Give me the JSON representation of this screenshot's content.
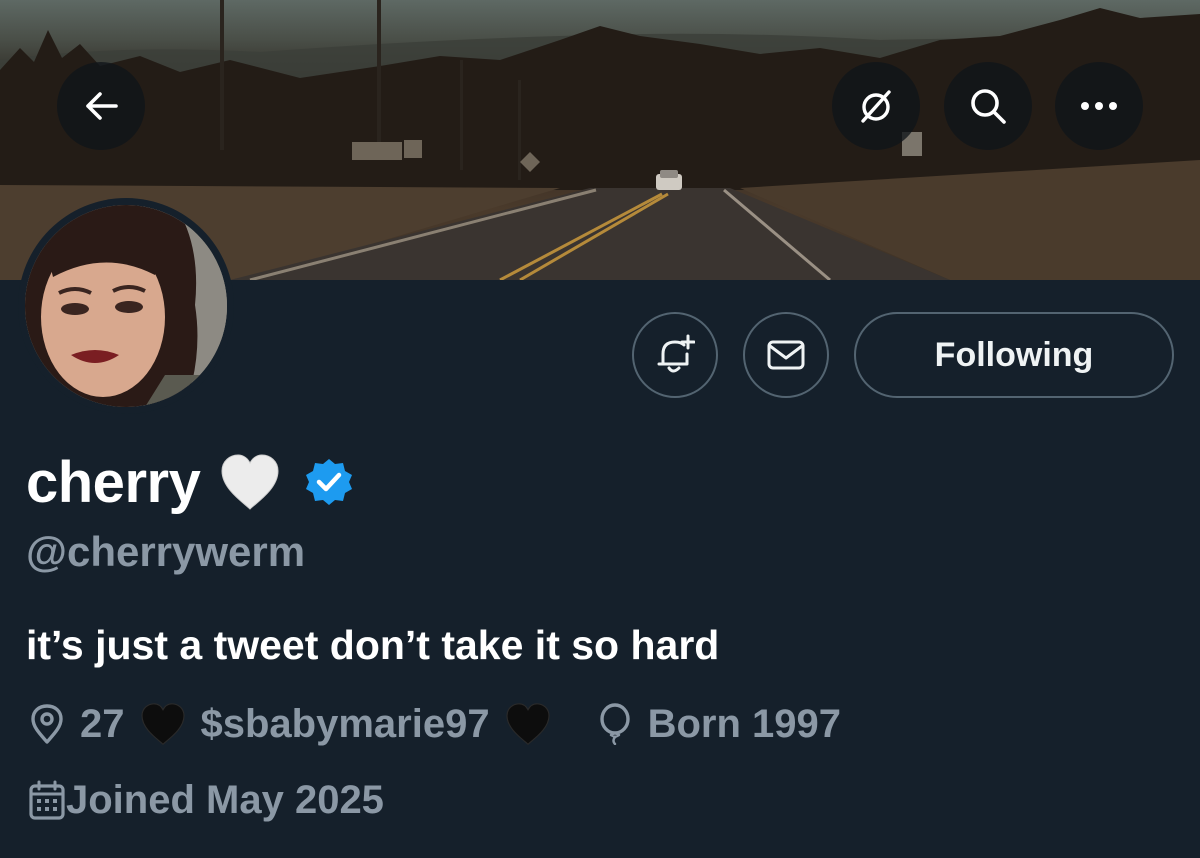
{
  "header": {
    "back_icon": "arrow-left-icon",
    "grok_icon": "grok-slash-circle-icon",
    "search_icon": "search-icon",
    "more_icon": "more-dots-icon"
  },
  "actions": {
    "notify_icon": "bell-plus-icon",
    "message_icon": "envelope-icon",
    "following_label": "Following"
  },
  "profile": {
    "display_name": "cherry",
    "name_emoji": "white-heart-icon",
    "verified_icon": "verified-badge-icon",
    "handle": "@cherrywerm",
    "bio": "it’s just a tweet don’t take it so hard",
    "location_icon": "location-pin-icon",
    "location_part1": "27",
    "location_part2": "$sbabymarie97",
    "location_emoji": "black-heart-icon",
    "birthday_icon": "balloon-icon",
    "birthday": "Born 1997",
    "joined_icon": "calendar-icon",
    "joined": "Joined May 2025"
  },
  "colors": {
    "background": "#15202b",
    "secondary_text": "#8b98a5",
    "border": "#536471",
    "verified_blue": "#1d9bf0"
  }
}
